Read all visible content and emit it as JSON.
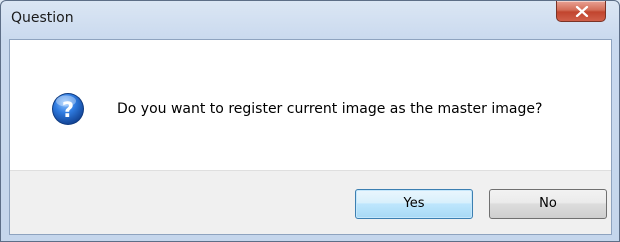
{
  "dialog": {
    "title": "Question",
    "close_icon": "close-x-icon",
    "message": "Do you want to register current image as the master image?",
    "icon": "question-icon",
    "buttons": {
      "yes_label": "Yes",
      "no_label": "No"
    },
    "colors": {
      "close_button": "#c1452e",
      "icon_blue": "#1f5fb8",
      "default_button_border": "#3c7fb1"
    }
  }
}
